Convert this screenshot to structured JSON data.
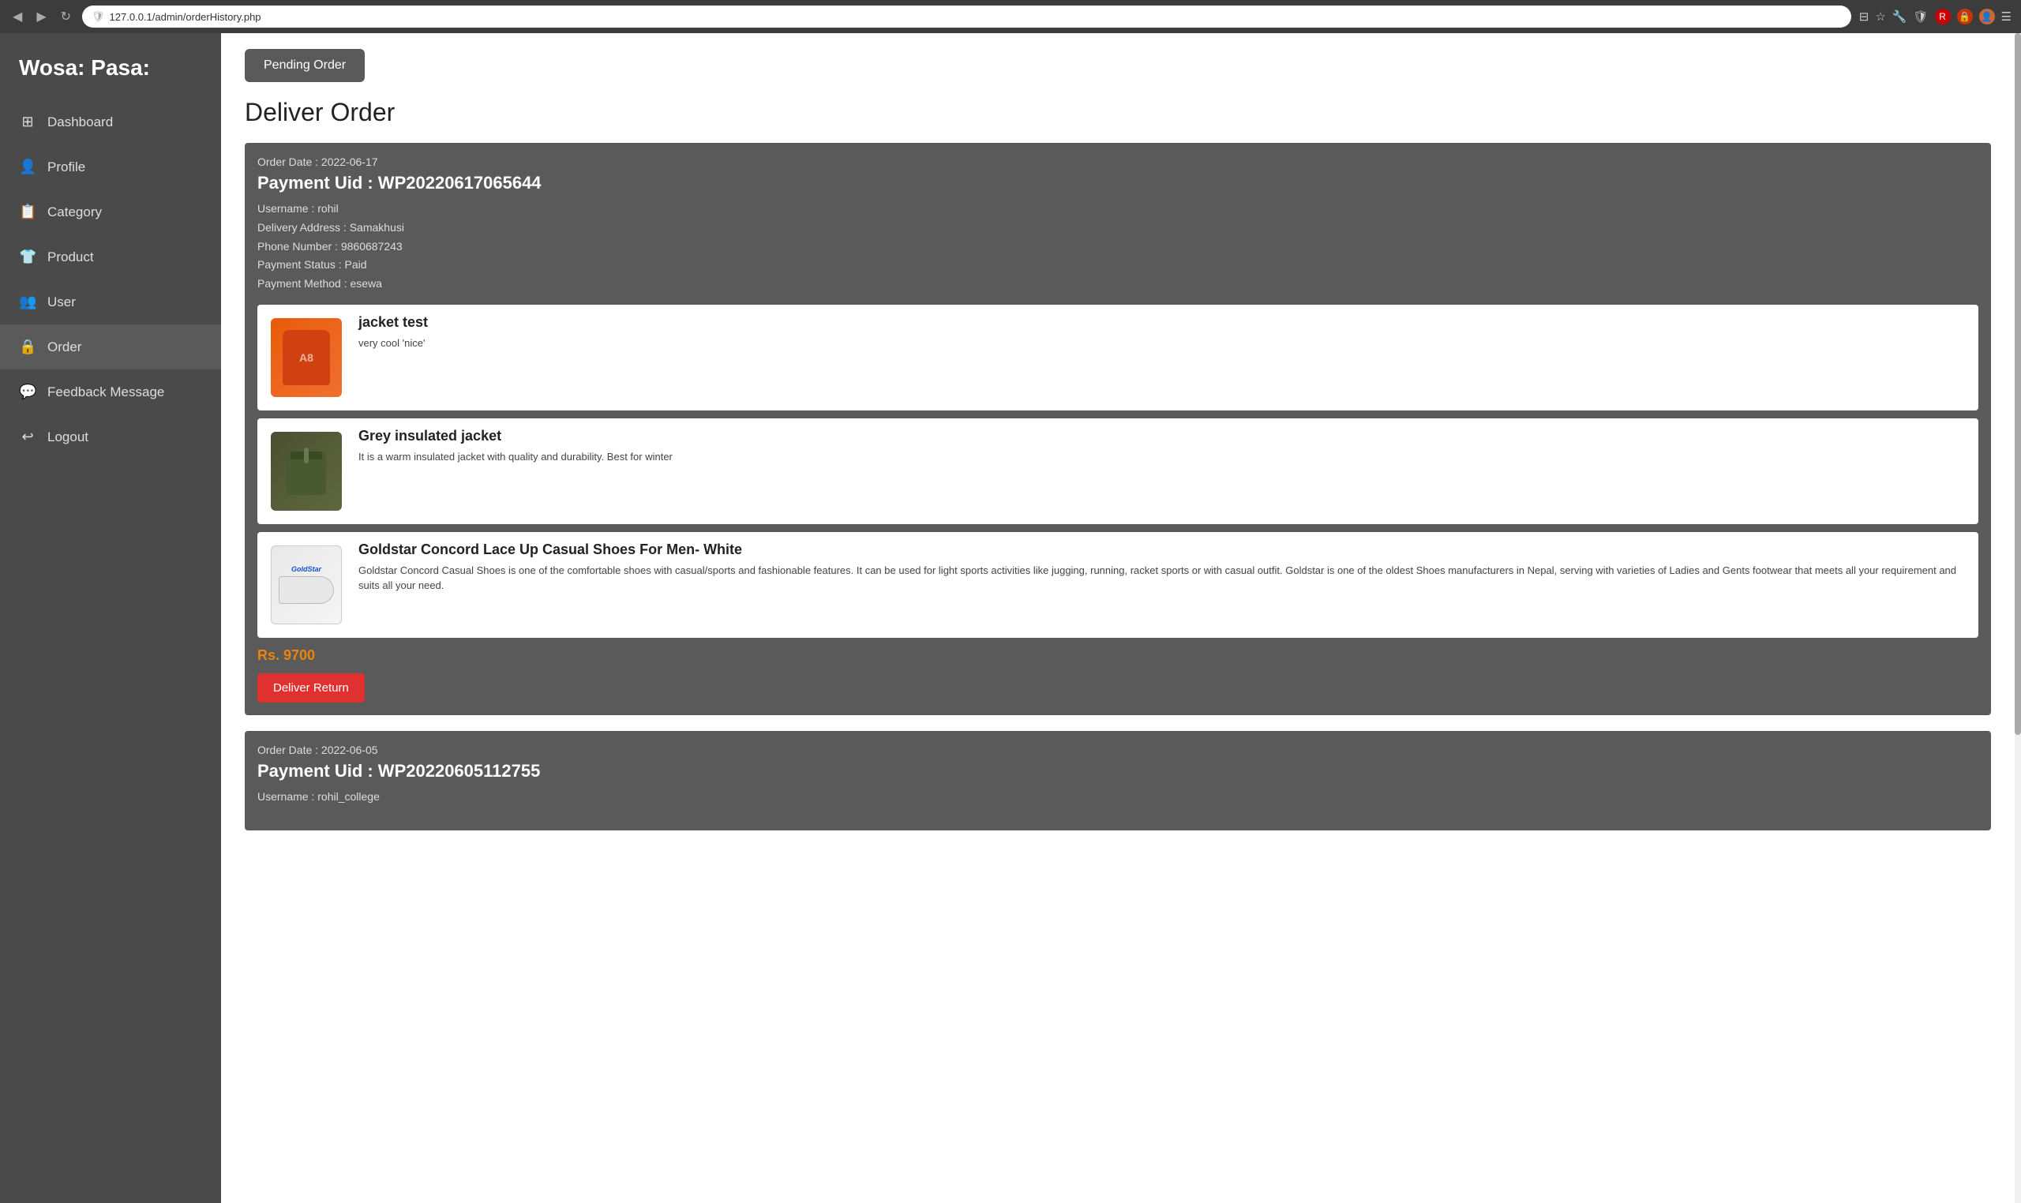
{
  "browser": {
    "url": "127.0.0.1/admin/orderHistory.php",
    "nav": {
      "back": "◀",
      "forward": "▶",
      "reload": "↺"
    }
  },
  "sidebar": {
    "title": "Wosa: Pasa:",
    "items": [
      {
        "id": "dashboard",
        "label": "Dashboard",
        "icon": "⊞"
      },
      {
        "id": "profile",
        "label": "Profile",
        "icon": "👤"
      },
      {
        "id": "category",
        "label": "Category",
        "icon": "📋"
      },
      {
        "id": "product",
        "label": "Product",
        "icon": "👕"
      },
      {
        "id": "user",
        "label": "User",
        "icon": "👥"
      },
      {
        "id": "order",
        "label": "Order",
        "icon": "🔒",
        "active": true
      },
      {
        "id": "feedback",
        "label": "Feedback Message",
        "icon": "💬"
      },
      {
        "id": "logout",
        "label": "Logout",
        "icon": "🚪"
      }
    ]
  },
  "main": {
    "pending_order_btn": "Pending Order",
    "page_title": "Deliver Order",
    "orders": [
      {
        "order_date": "Order Date : 2022-06-17",
        "payment_uid": "Payment Uid : WP20220617065644",
        "username": "Username : rohil",
        "delivery_address": "Delivery Address : Samakhusi",
        "phone_number": "Phone Number : 9860687243",
        "payment_status": "Payment Status : Paid",
        "payment_method": "Payment Method : esewa",
        "products": [
          {
            "name": "jacket test",
            "description": "very cool 'nice'",
            "image_type": "orange_jacket"
          },
          {
            "name": "Grey insulated jacket",
            "description": "It is a warm insulated jacket with quality and durability. Best for winter",
            "image_type": "olive_jacket"
          },
          {
            "name": "Goldstar Concord Lace Up Casual Shoes For Men- White",
            "description": "Goldstar Concord Casual Shoes is one of the comfortable shoes with casual/sports and fashionable features. It can be used for light sports activities like jugging, running, racket sports or with casual outfit. Goldstar is one of the oldest Shoes manufacturers in Nepal, serving with varieties of Ladies and Gents footwear that meets all your requirement and suits all your need.",
            "image_type": "white_shoes"
          }
        ],
        "total": "Rs. 9700",
        "deliver_return_btn": "Deliver Return"
      },
      {
        "order_date": "Order Date : 2022-06-05",
        "payment_uid": "Payment Uid : WP20220605112755",
        "username": "Username : rohil_college",
        "products": [],
        "total": "",
        "deliver_return_btn": ""
      }
    ]
  }
}
